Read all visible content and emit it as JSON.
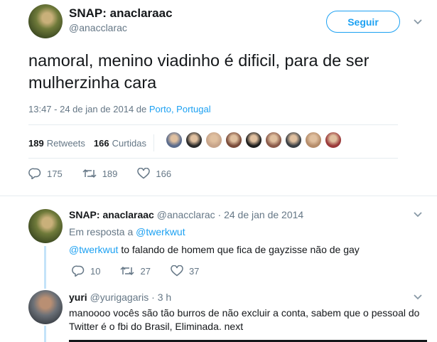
{
  "main_tweet": {
    "display_name": "SNAP: anaclaraac",
    "handle": "@anacclarac",
    "follow_label": "Seguir",
    "text": "namoral, menino viadinho é dificil, para de ser mulherzinha cara",
    "timestamp": "13:47 - 24 de jan de 2014 de ",
    "location": "Porto, Portugal",
    "retweets_count": "189",
    "retweets_label": "Retweets",
    "likes_count": "166",
    "likes_label": "Curtidas",
    "liker_colors": [
      "#5a6b8c",
      "#2a2a2a",
      "#c7a48a",
      "#7a4b3a",
      "#1e1e1e",
      "#8a5a4a",
      "#3a3f44",
      "#b58c6a",
      "#9a3a3a"
    ],
    "actions": {
      "replies": "175",
      "retweets": "189",
      "likes": "166"
    }
  },
  "reply": {
    "display_name": "SNAP: anaclaraac",
    "handle_time": "@anacclarac · 24 de jan de 2014",
    "in_reply_prefix": "Em resposta a ",
    "in_reply_to": "@twerkwut",
    "mention": "@twerkwut",
    "text": " to falando de homem que fica de gayzisse não de gay",
    "actions": {
      "replies": "10",
      "retweets": "27",
      "likes": "37"
    }
  },
  "reply2": {
    "display_name": "yuri",
    "handle_time": "@yurigagaris · 3 h",
    "text_line1": "manoooo vocês são tão burros de não excluir a conta, sabem que o pessoal do",
    "text_line2": "Twitter é o fbi do Brasil, Eliminada. next"
  },
  "colors": {
    "accent": "#1da1f2",
    "text": "#14171a",
    "muted": "#657786",
    "divider": "#e6ecf0"
  },
  "icons": [
    "chevron-down-icon",
    "reply-icon",
    "retweet-icon",
    "like-icon"
  ]
}
